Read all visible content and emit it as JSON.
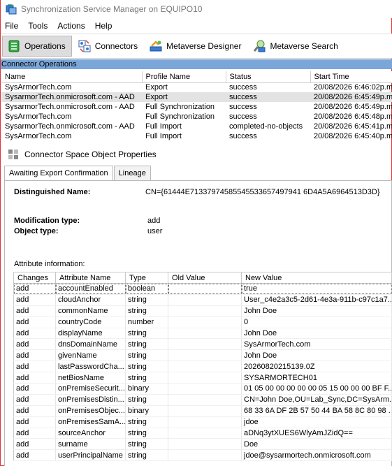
{
  "window": {
    "title": "Synchronization Service Manager on EQUIPO10"
  },
  "menu": [
    "File",
    "Tools",
    "Actions",
    "Help"
  ],
  "toolbar": {
    "operations": "Operations",
    "connectors": "Connectors",
    "metaverse_designer": "Metaverse Designer",
    "metaverse_search": "Metaverse Search"
  },
  "operations": {
    "section_title": "Connector Operations",
    "columns": [
      "Name",
      "Profile Name",
      "Status",
      "Start Time"
    ],
    "rows": [
      [
        "SysArmorTech.com",
        "Export",
        "success",
        "20/08/2026 6:46:02p.m."
      ],
      [
        "SysarmorTech.onmicrosoft.com - AAD",
        "Export",
        "success",
        "20/08/2026 6:45:49p.m."
      ],
      [
        "SysarmorTech.onmicrosoft.com - AAD",
        "Full Synchronization",
        "success",
        "20/08/2026 6:45:49p.m."
      ],
      [
        "SysArmorTech.com",
        "Full Synchronization",
        "success",
        "20/08/2026 6:45:48p.m."
      ],
      [
        "SysarmorTech.onmicrosoft.com - AAD",
        "Full Import",
        "completed-no-objects",
        "20/08/2026 6:45:41p.m."
      ],
      [
        "SysArmorTech.com",
        "Full Import",
        "success",
        "20/08/2026 6:45:40p.m."
      ]
    ]
  },
  "properties": {
    "title": "Connector Space Object Properties",
    "tabs": [
      "Awaiting Export Confirmation",
      "Lineage"
    ],
    "dn_label": "Distinguished Name:",
    "dn_value": "CN={61444E71337974585545533657497941 6D4A5A6964513D3D}",
    "mod_label": "Modification type:",
    "mod_value": "add",
    "obj_label": "Object type:",
    "obj_value": "user",
    "attr_caption": "Attribute information:"
  },
  "attributes": {
    "columns": [
      "Changes",
      "Attribute Name",
      "Type",
      "Old Value",
      "New Value"
    ],
    "rows": [
      [
        "add",
        "accountEnabled",
        "boolean",
        "",
        "true"
      ],
      [
        "add",
        "cloudAnchor",
        "string",
        "",
        "User_c4e2a3c5-2d61-4e3a-911b-c97c1a7..."
      ],
      [
        "add",
        "commonName",
        "string",
        "",
        "John Doe"
      ],
      [
        "add",
        "countryCode",
        "number",
        "",
        "0"
      ],
      [
        "add",
        "displayName",
        "string",
        "",
        "John Doe"
      ],
      [
        "add",
        "dnsDomainName",
        "string",
        "",
        "SysArmorTech.com"
      ],
      [
        "add",
        "givenName",
        "string",
        "",
        "John Doe"
      ],
      [
        "add",
        "lastPasswordCha...",
        "string",
        "",
        "20260820215139.0Z"
      ],
      [
        "add",
        "netBiosName",
        "string",
        "",
        "SYSARMORTECH01"
      ],
      [
        "add",
        "onPremiseSecurit...",
        "binary",
        "",
        "01 05 00 00 00 00 00 05 15 00 00 00 BF F..."
      ],
      [
        "add",
        "onPremisesDistin...",
        "string",
        "",
        "CN=John Doe,OU=Lab_Sync,DC=SysArm..."
      ],
      [
        "add",
        "onPremisesObjec...",
        "binary",
        "",
        "68 33 6A DF 2B 57 50 44 BA 58 8C 80 98 ..."
      ],
      [
        "add",
        "onPremisesSamA...",
        "string",
        "",
        "jdoe"
      ],
      [
        "add",
        "sourceAnchor",
        "string",
        "",
        "aDNq3ytXUES6WlyAmJZidQ=="
      ],
      [
        "add",
        "surname",
        "string",
        "",
        "Doe"
      ],
      [
        "add",
        "userPrincipalName",
        "string",
        "",
        "jdoe@sysarmortech.onmicrosoft.com"
      ]
    ]
  }
}
